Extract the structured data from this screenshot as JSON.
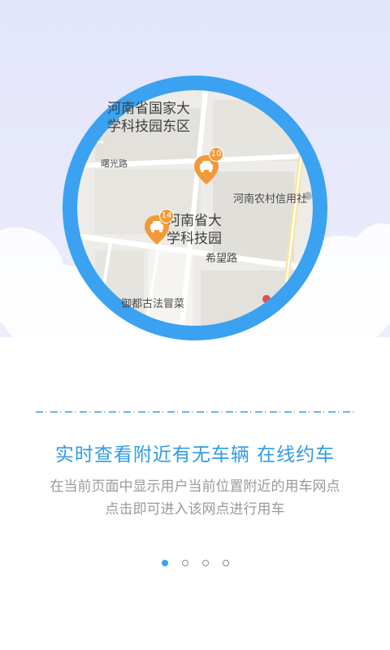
{
  "map": {
    "labels": [
      {
        "id": "university-park-east",
        "text": "河南省国家大\n学科技园东区"
      },
      {
        "id": "shuguang-road",
        "text": "曙光路"
      },
      {
        "id": "henan-rural-credit",
        "text": "河南农村信用社"
      },
      {
        "id": "henan-science-park",
        "text": "河南省大\n学科技园"
      },
      {
        "id": "xiwang-road",
        "text": "希望路"
      },
      {
        "id": "shop",
        "text": "御都古法冒菜"
      }
    ],
    "pins": [
      {
        "id": "pin-1",
        "count": "10"
      },
      {
        "id": "pin-2",
        "count": "14"
      }
    ]
  },
  "headline": "实时查看附近有无车辆 在线约车",
  "description": {
    "line1": "在当前页面中显示用户当前位置附近的用车网点",
    "line2": "点击即可进入该网点进行用车"
  },
  "pager": {
    "total": 4,
    "active_index": 0
  },
  "colors": {
    "accent": "#3aa2f0",
    "pin": "#f19a3a",
    "hero_bg": "#e6e7fb"
  }
}
